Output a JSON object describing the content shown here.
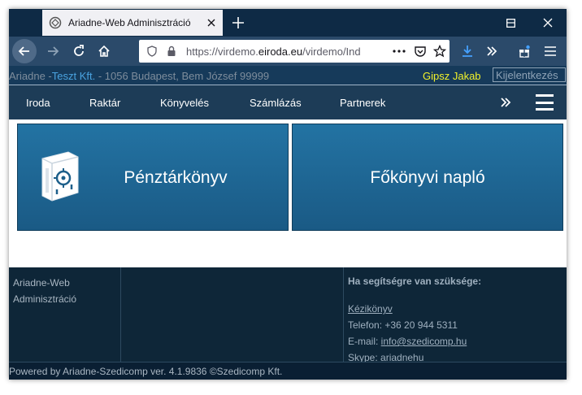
{
  "browser": {
    "tab_title": "Ariadne-Web Adminisztráció",
    "url_prefix": "https://virdemo.",
    "url_domain": "eiroda.eu",
    "url_suffix": "/virdemo/Ind"
  },
  "infobar": {
    "app": "Ariadne -",
    "firm": "Teszt Kft.",
    "address": "- 1056 Budapest, Bem József 99999",
    "user": "Gipsz Jakab",
    "logout": "Kijelentkezés"
  },
  "menu": {
    "items": [
      "Iroda",
      "Raktár",
      "Könyvelés",
      "Számlázás",
      "Partnerek"
    ]
  },
  "cards": {
    "left": "Pénztárkönyv",
    "right": "Főkönyvi napló"
  },
  "footer": {
    "brand_line1": "Ariadne-Web",
    "brand_line2": "Adminisztráció",
    "help_title": "Ha segítségre van szüksége:",
    "manual": "Kézikönyv",
    "phone": "Telefon: +36 20 944 5311",
    "email_label": "E-mail: ",
    "email": "info@szedicomp.hu",
    "skype": "Skype: ariadnehu",
    "powered": "Powered by Ariadne-Szedicomp ver. 4.1.9836 ©Szedicomp Kft."
  },
  "icons": [
    "ariadne-favicon",
    "close-icon",
    "plus-icon",
    "minimize-icon",
    "maximize-icon",
    "back-icon",
    "forward-icon",
    "reload-icon",
    "home-icon",
    "shield-icon",
    "lock-icon",
    "more-dots-icon",
    "pocket-icon",
    "star-icon",
    "download-icon",
    "chevrons-right-icon",
    "gift-icon",
    "menu-icon",
    "safe-icon"
  ],
  "colors": {
    "titlebar": "#0e2a45",
    "card": "#1f6a98",
    "footer": "#0e2638",
    "user": "#f1f22a",
    "firm": "#4aa3e0"
  }
}
